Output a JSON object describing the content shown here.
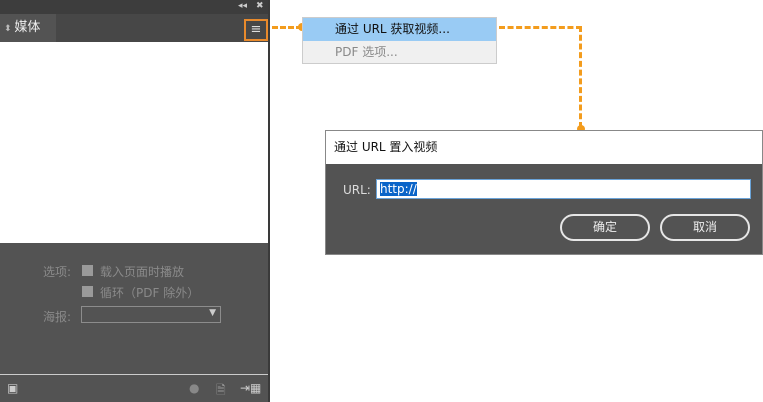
{
  "panel": {
    "collapse_icon": "double-left-arrow",
    "close_icon": "close",
    "tab_label": "媒体",
    "options_label": "选项:",
    "play_on_load": "载入页面时播放",
    "loop": "循环（PDF 除外）",
    "poster_label": "海报:",
    "poster_value": ""
  },
  "menu": {
    "items": [
      {
        "label": "通过 URL 获取视频...",
        "highlighted": true
      },
      {
        "label": "PDF 选项...",
        "disabled": true
      }
    ]
  },
  "dialog": {
    "title": "通过 URL 置入视频",
    "url_label": "URL:",
    "url_value": "http://",
    "ok": "确定",
    "cancel": "取消"
  },
  "colors": {
    "accent": "#f39c1d",
    "highlight": "#99cbf4"
  }
}
